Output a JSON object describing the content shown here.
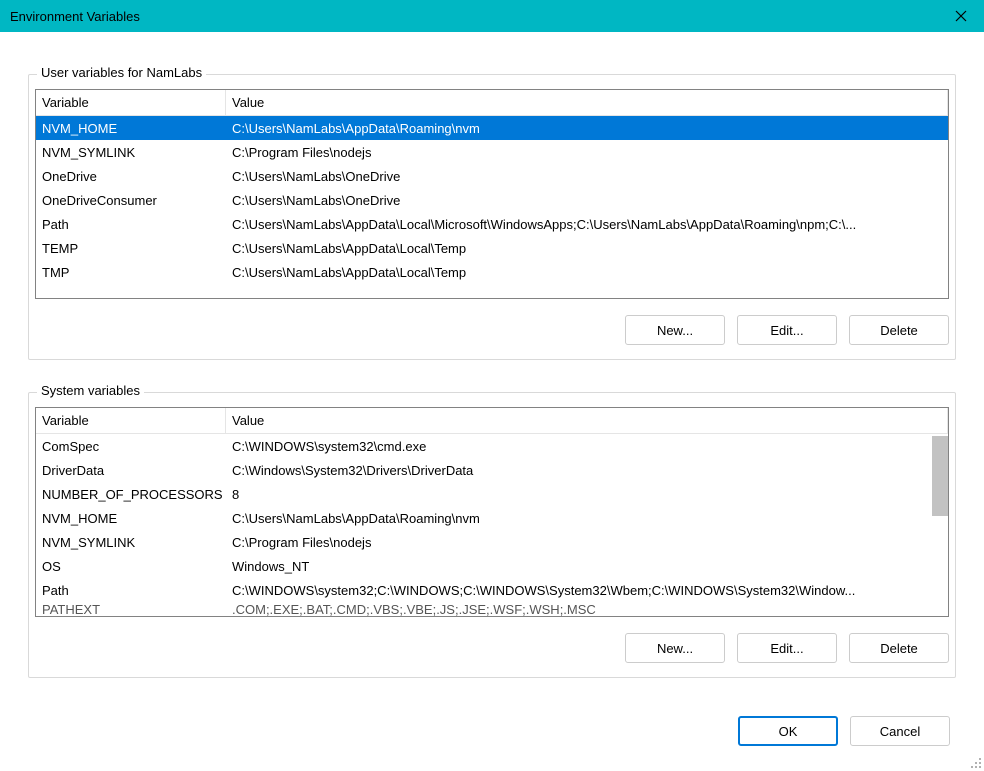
{
  "window": {
    "title": "Environment Variables"
  },
  "userSection": {
    "label": "User variables for NamLabs",
    "headers": {
      "name": "Variable",
      "value": "Value"
    },
    "rows": [
      {
        "name": "NVM_HOME",
        "value": "C:\\Users\\NamLabs\\AppData\\Roaming\\nvm",
        "selected": true
      },
      {
        "name": "NVM_SYMLINK",
        "value": "C:\\Program Files\\nodejs",
        "selected": false
      },
      {
        "name": "OneDrive",
        "value": "C:\\Users\\NamLabs\\OneDrive",
        "selected": false
      },
      {
        "name": "OneDriveConsumer",
        "value": "C:\\Users\\NamLabs\\OneDrive",
        "selected": false
      },
      {
        "name": "Path",
        "value": "C:\\Users\\NamLabs\\AppData\\Local\\Microsoft\\WindowsApps;C:\\Users\\NamLabs\\AppData\\Roaming\\npm;C:\\...",
        "selected": false
      },
      {
        "name": "TEMP",
        "value": "C:\\Users\\NamLabs\\AppData\\Local\\Temp",
        "selected": false
      },
      {
        "name": "TMP",
        "value": "C:\\Users\\NamLabs\\AppData\\Local\\Temp",
        "selected": false
      }
    ],
    "buttons": {
      "new": "New...",
      "edit": "Edit...",
      "delete": "Delete"
    }
  },
  "systemSection": {
    "label": "System variables",
    "headers": {
      "name": "Variable",
      "value": "Value"
    },
    "rows": [
      {
        "name": "ComSpec",
        "value": "C:\\WINDOWS\\system32\\cmd.exe"
      },
      {
        "name": "DriverData",
        "value": "C:\\Windows\\System32\\Drivers\\DriverData"
      },
      {
        "name": "NUMBER_OF_PROCESSORS",
        "value": "8"
      },
      {
        "name": "NVM_HOME",
        "value": "C:\\Users\\NamLabs\\AppData\\Roaming\\nvm"
      },
      {
        "name": "NVM_SYMLINK",
        "value": "C:\\Program Files\\nodejs"
      },
      {
        "name": "OS",
        "value": "Windows_NT"
      },
      {
        "name": "Path",
        "value": "C:\\WINDOWS\\system32;C:\\WINDOWS;C:\\WINDOWS\\System32\\Wbem;C:\\WINDOWS\\System32\\Window..."
      }
    ],
    "partialRow": {
      "name": "PATHEXT",
      "value": ".COM;.EXE;.BAT;.CMD;.VBS;.VBE;.JS;.JSE;.WSF;.WSH;.MSC"
    },
    "buttons": {
      "new": "New...",
      "edit": "Edit...",
      "delete": "Delete"
    }
  },
  "dialog": {
    "ok": "OK",
    "cancel": "Cancel"
  }
}
